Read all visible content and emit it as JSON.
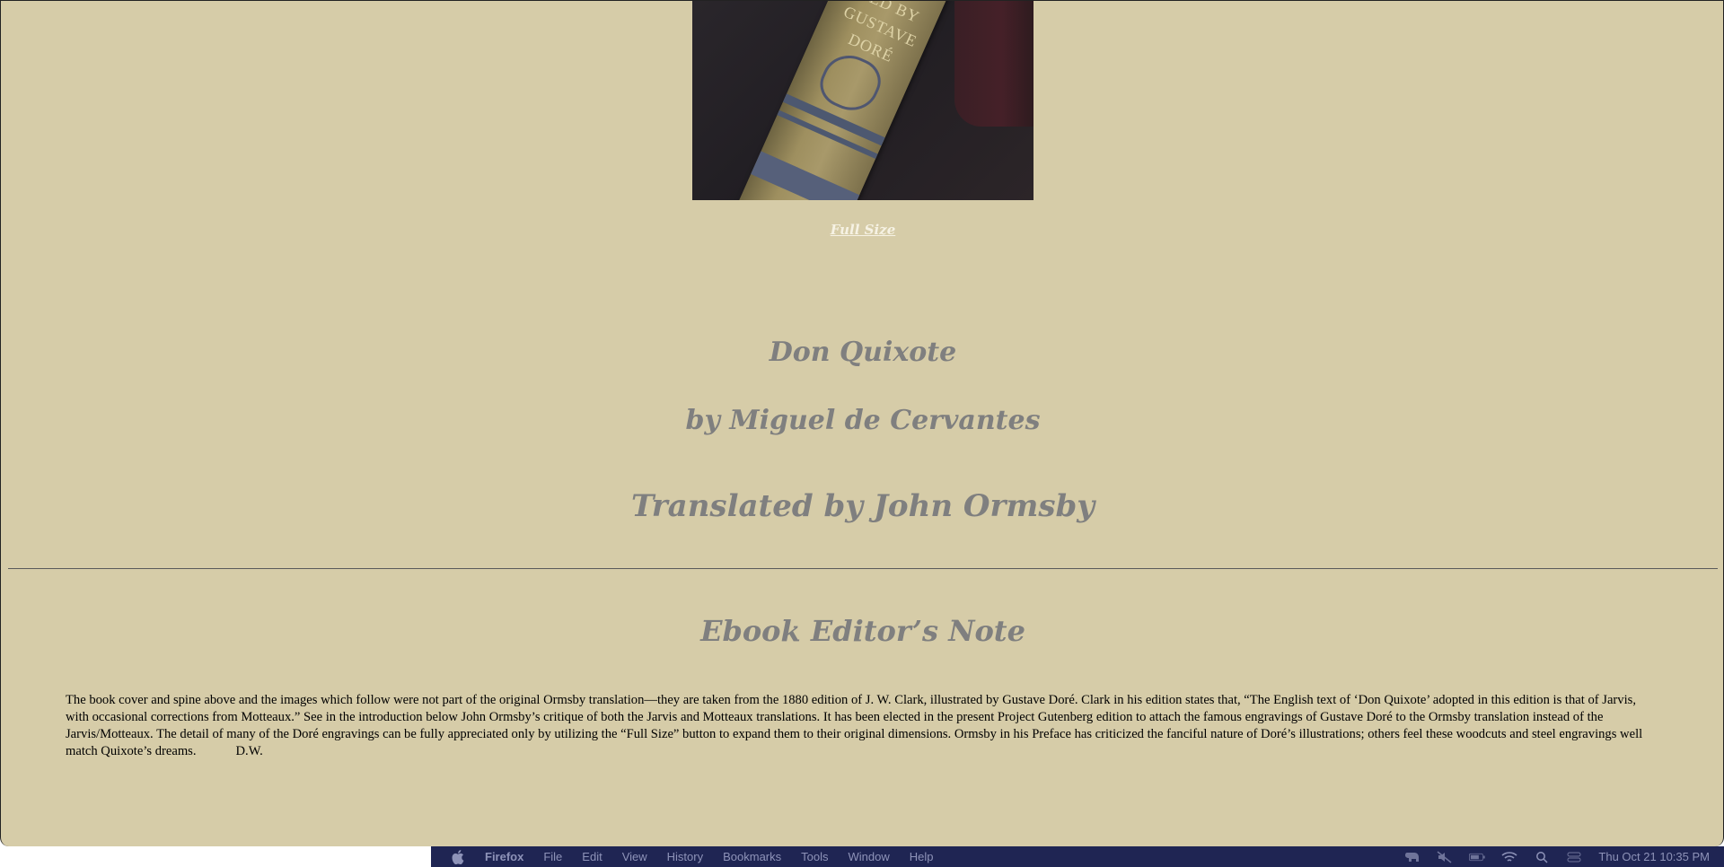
{
  "page": {
    "full_size_link": "Full Size",
    "title": "Don Quixote",
    "author": "by Miguel de Cervantes",
    "translator": "Translated by John Ormsby",
    "section_heading": "Ebook Editor’s Note",
    "note_text": "The book cover and spine above and the images which follow were not part of the original Ormsby translation—they are taken from the 1880 edition of J. W. Clark, illustrated by Gustave Doré. Clark in his edition states that, “The English text of ‘Don Quixote’ adopted in this edition is that of Jarvis, with occasional corrections from Motteaux.” See in the introduction below John Ormsby’s critique of both the Jarvis and Motteaux translations. It has been elected in the present Project Gutenberg edition to attach the famous engravings of Gustave Doré to the Ormsby translation instead of the Jarvis/Motteaux. The detail of many of the Doré engravings can be fully appreciated only by utilizing the “Full Size” button to expand them to their original dimensions. Ormsby in his Preface has criticized the fanciful nature of Doré’s illustrations; others feel these woodcuts and steel engravings well match Quixote’s dreams.",
    "note_signature": "D.W.",
    "cover_spine_text": "TED BY GUSTAVE DORÉ"
  },
  "menubar": {
    "app_name": "Firefox",
    "items": [
      "File",
      "Edit",
      "View",
      "History",
      "Bookmarks",
      "Tools",
      "Window",
      "Help"
    ],
    "clock": "Thu Oct 21  10:35 PM",
    "status_icons": [
      "evernote-elephant-icon",
      "muted-speaker-icon",
      "battery-icon",
      "wifi-icon",
      "spotlight-search-icon",
      "control-center-icon"
    ]
  },
  "colors": {
    "page_background": "#d6cca8",
    "heading_gray": "#7f7f7f",
    "menubar_bg": "#1f2553"
  }
}
